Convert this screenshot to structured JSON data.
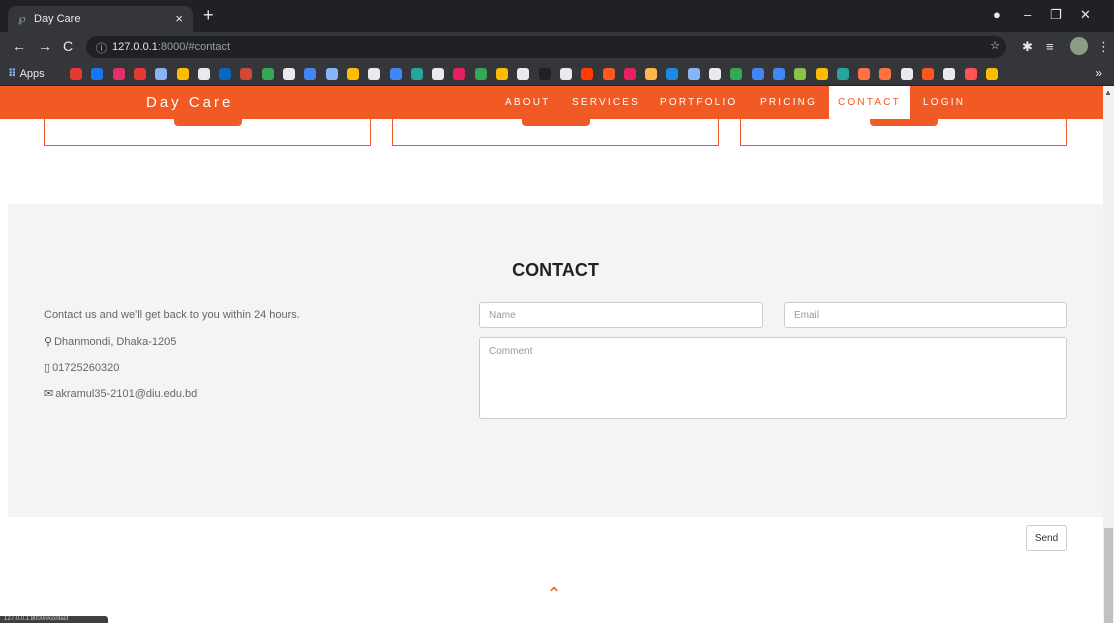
{
  "browser": {
    "tab_title": "Day Care",
    "tab_close": "×",
    "new_tab": "+",
    "url_host": "127.0.0.1",
    "url_path": ":8000/#contact",
    "bookmarks_apps": "Apps",
    "bookmarks_more": "»",
    "status_url": "127.0.0.1:8000/#contact"
  },
  "site": {
    "brand": "Day Care",
    "nav": [
      "ABOUT",
      "SERVICES",
      "PORTFOLIO",
      "PRICING",
      "CONTACT",
      "LOGIN"
    ],
    "active_nav": "CONTACT"
  },
  "contact": {
    "title": "CONTACT",
    "intro": "Contact us and we'll get back to you within 24 hours.",
    "address": "Dhanmondi, Dhaka-1205",
    "phone": "01725260320",
    "email": "akramul35-2101@diu.edu.bd",
    "form": {
      "name_placeholder": "Name",
      "email_placeholder": "Email",
      "comment_placeholder": "Comment",
      "send_label": "Send"
    }
  },
  "colors": {
    "accent": "#f15a24",
    "section_bg": "#f4f4f4",
    "chrome_dark": "#202124"
  }
}
